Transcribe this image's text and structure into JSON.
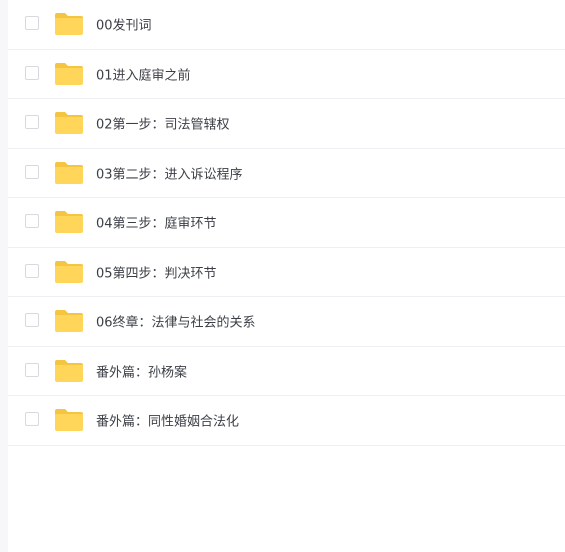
{
  "folders": [
    {
      "name": "00发刊词"
    },
    {
      "name": "01进入庭审之前"
    },
    {
      "name": "02第一步：司法管辖权"
    },
    {
      "name": "03第二步：进入诉讼程序"
    },
    {
      "name": "04第三步：庭审环节"
    },
    {
      "name": "05第四步：判决环节"
    },
    {
      "name": "06终章：法律与社会的关系"
    },
    {
      "name": "番外篇：孙杨案"
    },
    {
      "name": "番外篇：同性婚姻合法化"
    }
  ],
  "colors": {
    "folder_body": "#ffd659",
    "folder_tab": "#f5c542",
    "text": "#3b3f45",
    "divider": "#eef0f4",
    "checkbox_border": "#d6d9df"
  },
  "icons": {
    "item_icon": "folder-icon"
  }
}
